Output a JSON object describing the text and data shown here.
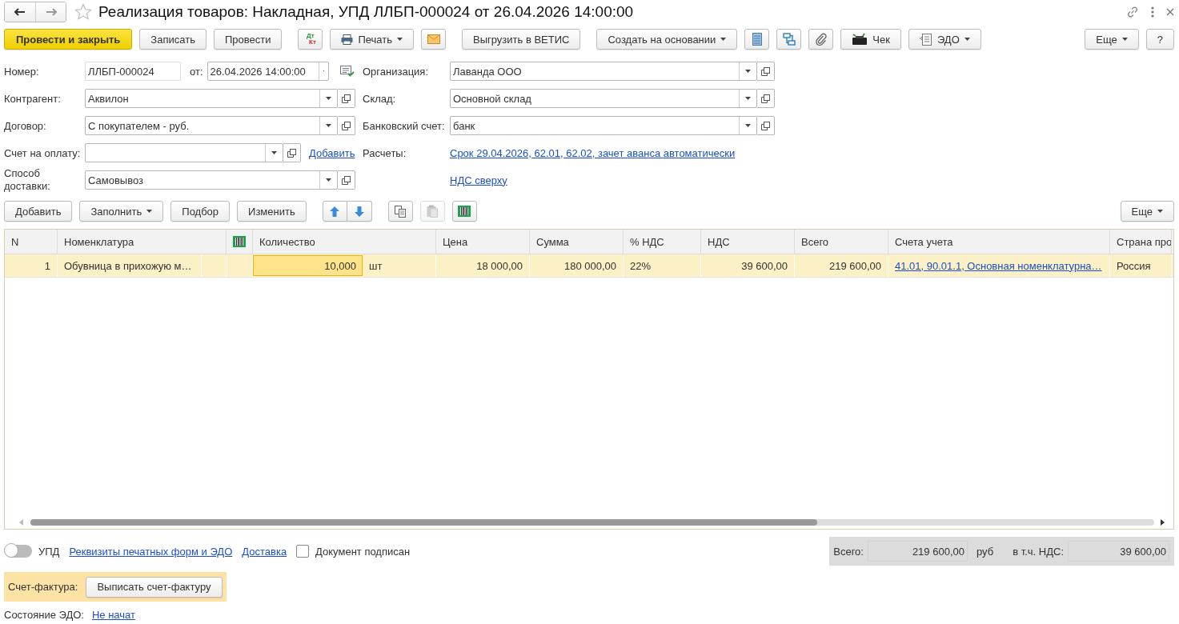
{
  "window": {
    "title": "Реализация товаров: Накладная, УПД ЛЛБП-000024 от 26.04.2026 14:00:00",
    "favorite": false
  },
  "toolbar": [
    {
      "kind": "primary",
      "label": "Провести и закрыть"
    },
    {
      "kind": "plain",
      "label": "Записать"
    },
    {
      "kind": "plain",
      "label": "Провести"
    },
    {
      "kind": "ledger",
      "debit": "Дт",
      "credit": "Кт"
    },
    {
      "kind": "print",
      "label": "Печать",
      "menu": true
    },
    {
      "kind": "mail"
    },
    {
      "kind": "plain",
      "label": "Выгрузить в ВЕТИС"
    },
    {
      "kind": "plain",
      "label": "Создать на основании",
      "menu": true
    },
    {
      "kind": "list"
    },
    {
      "kind": "structure"
    },
    {
      "kind": "clip"
    },
    {
      "kind": "receipt",
      "label": "Чек"
    },
    {
      "kind": "edo",
      "label": "ЭДО",
      "menu": true
    }
  ],
  "toolbar_right": [
    {
      "label": "Еще",
      "menu": true
    },
    {
      "label": "?",
      "menu": false
    }
  ],
  "form": {
    "number": {
      "label": "Номер:",
      "value": "ЛЛБП-000024"
    },
    "date": {
      "label": "от:",
      "value": "26.04.2026 14:00:00"
    },
    "counterparty": {
      "label": "Контрагент:",
      "value": "Аквилон"
    },
    "contract": {
      "label": "Договор:",
      "value": "С покупателем - руб."
    },
    "payment_invoice": {
      "label": "Счет на оплату:",
      "link": "Добавить"
    },
    "delivery": {
      "label": "Способ доставки:",
      "value": "Самовывоз"
    },
    "organization": {
      "label": "Организация:",
      "value": "Лаванда ООО"
    },
    "warehouse": {
      "label": "Склад:",
      "value": "Основной склад"
    },
    "bank_account": {
      "label": "Банковский счет:",
      "value": "банк"
    },
    "settlements": {
      "label": "Расчеты:",
      "link": "Срок 29.04.2026, 62.01, 62.02, зачет аванса автоматически"
    },
    "vat_link": "НДС сверху"
  },
  "table_toolbar": [
    {
      "kind": "plain",
      "label": "Добавить"
    },
    {
      "kind": "plain",
      "label": "Заполнить",
      "menu": true
    },
    {
      "kind": "plain",
      "label": "Подбор"
    },
    {
      "kind": "plain",
      "label": "Изменить"
    },
    {
      "kind": "updown"
    },
    {
      "kind": "copy",
      "disabled": false
    },
    {
      "kind": "paste",
      "disabled": true
    },
    {
      "kind": "barcode"
    }
  ],
  "table_toolbar_right": [
    {
      "label": "Еще",
      "menu": true
    }
  ],
  "table": {
    "columns": [
      {
        "kind": "text",
        "label": "N"
      },
      {
        "kind": "text",
        "label": "Номенклатура"
      },
      {
        "kind": "barcode"
      },
      {
        "kind": "text",
        "label": "Количество"
      },
      {
        "kind": "text",
        "label": "Цена"
      },
      {
        "kind": "text",
        "label": "Сумма"
      },
      {
        "kind": "text",
        "label": "% НДС"
      },
      {
        "kind": "text",
        "label": "НДС"
      },
      {
        "kind": "text",
        "label": "Всего"
      },
      {
        "kind": "text",
        "label": "Счета учета"
      },
      {
        "kind": "text",
        "label": "Страна про"
      }
    ],
    "rows": [
      {
        "selected": true,
        "n": "1",
        "item": "Обувница в прихожую м…",
        "quantity": "10,000",
        "unit": "шт",
        "price": "18 000,00",
        "sum": "180 000,00",
        "vat_rate": "22%",
        "vat": "39 600,00",
        "total": "219 600,00",
        "accounts": "41.01, 90.01.1, Основная номенклатурна…",
        "country": "Россия"
      }
    ]
  },
  "footer": {
    "upd": {
      "label": "УПД",
      "on": false
    },
    "links": [
      "Реквизиты печатных форм и ЭДО",
      "Доставка"
    ],
    "signed": {
      "label": "Документ подписан",
      "checked": false
    },
    "totals": {
      "total_label": "Всего:",
      "total": "219 600,00",
      "currency": "руб",
      "vat_label": "в т.ч. НДС:",
      "vat": "39 600,00"
    },
    "invoice": {
      "label": "Счет-фактура:",
      "button": "Выписать счет-фактуру"
    },
    "edo_state": {
      "label": "Состояние ЭДО:",
      "link": "Не начат"
    }
  }
}
